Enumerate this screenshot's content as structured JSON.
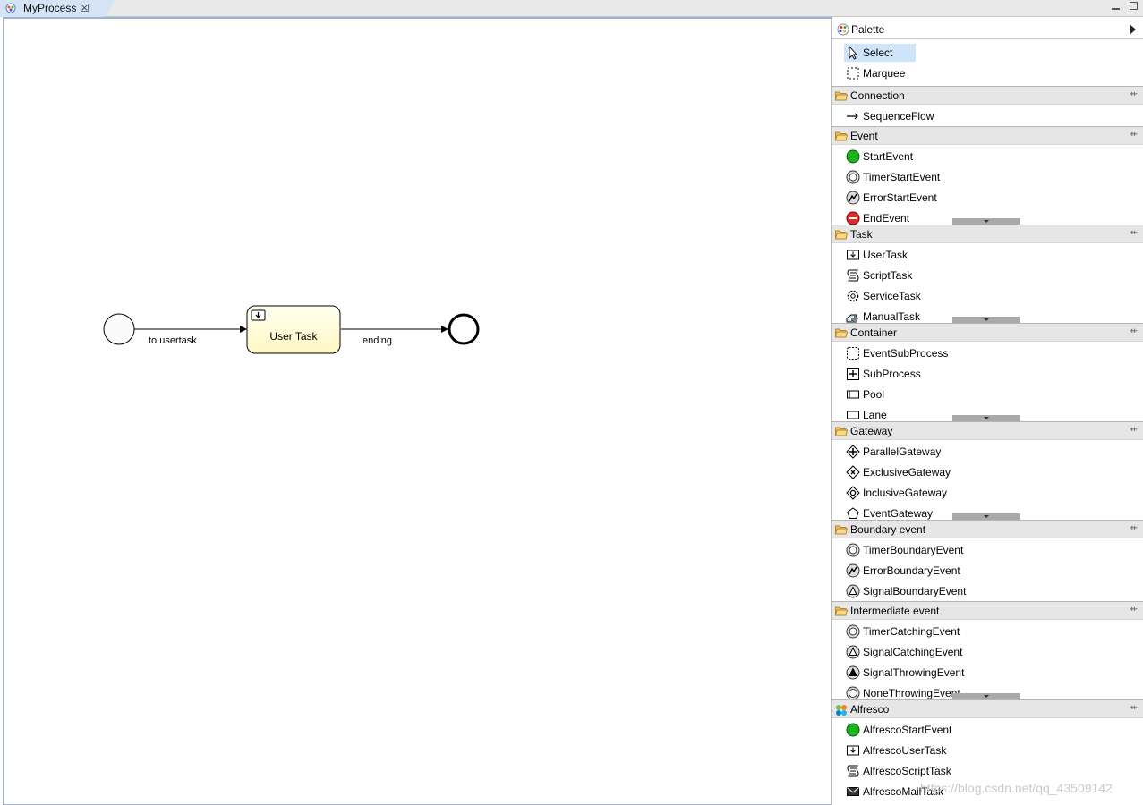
{
  "tab": {
    "title": "MyProcess",
    "close": "☒"
  },
  "diagram": {
    "flows": [
      {
        "label": "to usertask"
      },
      {
        "label": "ending"
      }
    ],
    "task": {
      "label": "User Task"
    }
  },
  "palette": {
    "title": "Palette",
    "tools": [
      {
        "label": "Select",
        "icon": "cursor-icon",
        "selected": true
      },
      {
        "label": "Marquee",
        "icon": "marquee-icon"
      }
    ],
    "drawers": [
      {
        "label": "Connection",
        "items": [
          {
            "label": "SequenceFlow",
            "icon": "arrow-icon"
          }
        ]
      },
      {
        "label": "Event",
        "scroll": true,
        "items": [
          {
            "label": "StartEvent",
            "icon": "start-event-icon"
          },
          {
            "label": "TimerStartEvent",
            "icon": "timer-icon"
          },
          {
            "label": "ErrorStartEvent",
            "icon": "error-icon"
          },
          {
            "label": "EndEvent",
            "icon": "end-event-icon"
          }
        ]
      },
      {
        "label": "Task",
        "scroll": true,
        "items": [
          {
            "label": "UserTask",
            "icon": "user-task-icon"
          },
          {
            "label": "ScriptTask",
            "icon": "script-task-icon"
          },
          {
            "label": "ServiceTask",
            "icon": "service-task-icon"
          },
          {
            "label": "ManualTask",
            "icon": "manual-task-icon"
          }
        ]
      },
      {
        "label": "Container",
        "scroll": true,
        "items": [
          {
            "label": "EventSubProcess",
            "icon": "event-subprocess-icon"
          },
          {
            "label": "SubProcess",
            "icon": "subprocess-icon"
          },
          {
            "label": "Pool",
            "icon": "pool-icon"
          },
          {
            "label": "Lane",
            "icon": "lane-icon"
          }
        ]
      },
      {
        "label": "Gateway",
        "scroll": true,
        "items": [
          {
            "label": "ParallelGateway",
            "icon": "parallel-gateway-icon"
          },
          {
            "label": "ExclusiveGateway",
            "icon": "exclusive-gateway-icon"
          },
          {
            "label": "InclusiveGateway",
            "icon": "inclusive-gateway-icon"
          },
          {
            "label": "EventGateway",
            "icon": "event-gateway-icon"
          }
        ]
      },
      {
        "label": "Boundary event",
        "items": [
          {
            "label": "TimerBoundaryEvent",
            "icon": "timer-icon"
          },
          {
            "label": "ErrorBoundaryEvent",
            "icon": "error-icon"
          },
          {
            "label": "SignalBoundaryEvent",
            "icon": "signal-icon"
          }
        ]
      },
      {
        "label": "Intermediate event",
        "scroll": true,
        "items": [
          {
            "label": "TimerCatchingEvent",
            "icon": "timer-icon"
          },
          {
            "label": "SignalCatchingEvent",
            "icon": "signal-icon"
          },
          {
            "label": "SignalThrowingEvent",
            "icon": "signal-throw-icon"
          },
          {
            "label": "NoneThrowingEvent",
            "icon": "none-throw-icon"
          }
        ]
      },
      {
        "label": "Alfresco",
        "alfresco": true,
        "items": [
          {
            "label": "AlfrescoStartEvent",
            "icon": "start-event-icon"
          },
          {
            "label": "AlfrescoUserTask",
            "icon": "user-task-icon"
          },
          {
            "label": "AlfrescoScriptTask",
            "icon": "script-task-icon"
          },
          {
            "label": "AlfrescoMailTask",
            "icon": "mail-task-icon"
          }
        ]
      }
    ]
  },
  "watermark": "https://blog.csdn.net/qq_43509142"
}
